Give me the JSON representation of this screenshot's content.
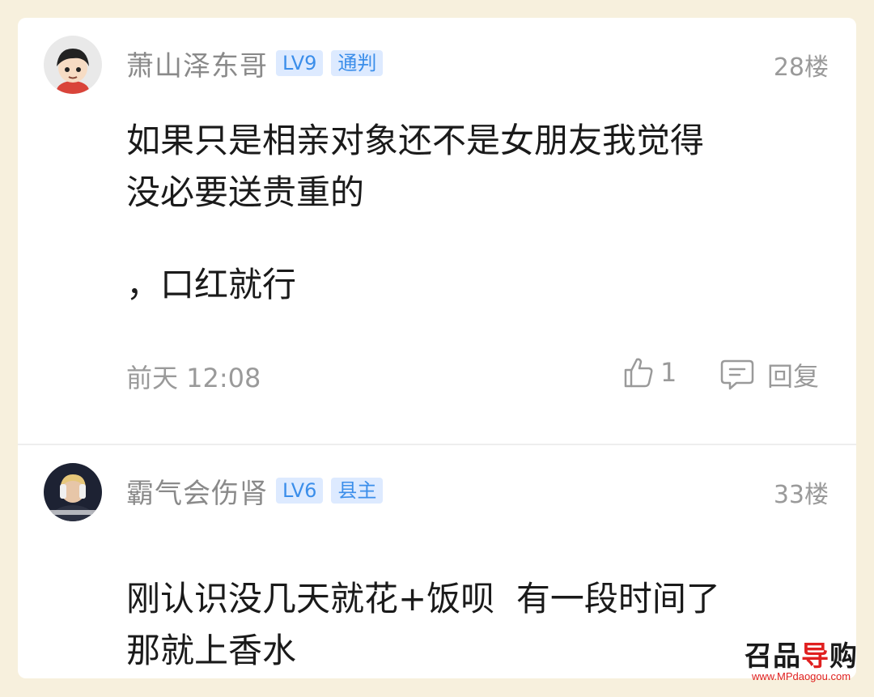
{
  "posts": [
    {
      "username": "萧山泽东哥",
      "level": "LV9",
      "title": "通判",
      "floor": "28楼",
      "content_lines": [
        "如果只是相亲对象还不是女朋友我觉得",
        "没必要送贵重的"
      ],
      "content_extra": "，口红就行",
      "time": "前天 12:08",
      "likes": "1",
      "reply_label": "回复"
    },
    {
      "username": "霸气会伤肾",
      "level": "LV6",
      "title": "县主",
      "floor": "33楼",
      "content_lines": [
        "刚认识没几天就花+饭呗  有一段时间了",
        "那就上香水"
      ]
    }
  ],
  "watermark": {
    "logo_a": "召品",
    "logo_b": "导",
    "logo_c": "购",
    "url": "www.MPdaogou.com"
  },
  "icons": {
    "like": "thumbs-up-icon",
    "reply": "comment-bubble-icon"
  },
  "colors": {
    "background": "#f7f0dd",
    "badge_text": "#3b8eea",
    "badge_bg": "#ddeaff",
    "meta_text": "#9a9a9a",
    "watermark_red": "#e02020"
  }
}
